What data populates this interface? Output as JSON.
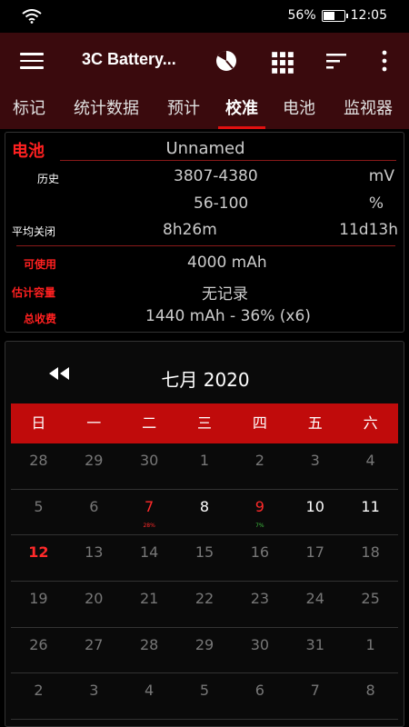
{
  "status": {
    "battery_pct": "56%",
    "time": "12:05",
    "battery_level": 0.56
  },
  "appbar": {
    "title": "3C Battery..."
  },
  "tabs": [
    "标记",
    "统计数据",
    "预计",
    "校准",
    "电池",
    "监视器"
  ],
  "active_tab": 3,
  "battery_card": {
    "section_title": "电池",
    "device_name": "Unnamed",
    "history_label": "历史",
    "history_mv": "3807-4380",
    "history_mv_unit": "mV",
    "history_pct": "56-100",
    "history_pct_unit": "%",
    "avg_off_label": "平均关闭",
    "avg_off_value1": "8h26m",
    "avg_off_value2": "11d13h",
    "usable_label": "可使用",
    "usable_value": "4000 mAh",
    "est_capacity_label": "估计容量",
    "est_capacity_value": "无记录",
    "total_charge_label": "总收费",
    "total_charge_value": "1440 mAh - 36% (x6)"
  },
  "calendar": {
    "title": "七月  2020",
    "weekdays": [
      "日",
      "一",
      "二",
      "三",
      "四",
      "五",
      "六"
    ],
    "weeks": [
      [
        {
          "d": "28"
        },
        {
          "d": "29"
        },
        {
          "d": "30"
        },
        {
          "d": "1"
        },
        {
          "d": "2"
        },
        {
          "d": "3"
        },
        {
          "d": "4"
        }
      ],
      [
        {
          "d": "5"
        },
        {
          "d": "6"
        },
        {
          "d": "7",
          "cls": "red",
          "sub": "28%",
          "subcls": "red"
        },
        {
          "d": "8",
          "cls": "cur"
        },
        {
          "d": "9",
          "cls": "red",
          "sub": "7%",
          "subcls": "green"
        },
        {
          "d": "10",
          "cls": "cur"
        },
        {
          "d": "11",
          "cls": "cur"
        }
      ],
      [
        {
          "d": "12",
          "cls": "today"
        },
        {
          "d": "13"
        },
        {
          "d": "14"
        },
        {
          "d": "15"
        },
        {
          "d": "16"
        },
        {
          "d": "17"
        },
        {
          "d": "18"
        }
      ],
      [
        {
          "d": "19"
        },
        {
          "d": "20"
        },
        {
          "d": "21"
        },
        {
          "d": "22"
        },
        {
          "d": "23"
        },
        {
          "d": "24"
        },
        {
          "d": "25"
        }
      ],
      [
        {
          "d": "26"
        },
        {
          "d": "27"
        },
        {
          "d": "28"
        },
        {
          "d": "29"
        },
        {
          "d": "30"
        },
        {
          "d": "31"
        },
        {
          "d": "1"
        }
      ],
      [
        {
          "d": "2"
        },
        {
          "d": "3"
        },
        {
          "d": "4"
        },
        {
          "d": "5"
        },
        {
          "d": "6"
        },
        {
          "d": "7"
        },
        {
          "d": "8"
        }
      ]
    ]
  },
  "colors": {
    "accent": "#c00b0b",
    "appbar": "#3a0a0d",
    "label_red": "#ff2020"
  },
  "icons": [
    "wifi-icon",
    "battery-icon",
    "menu-icon",
    "pie-chart-icon",
    "grid-icon",
    "sort-icon",
    "more-vert-icon",
    "rewind-icon"
  ]
}
